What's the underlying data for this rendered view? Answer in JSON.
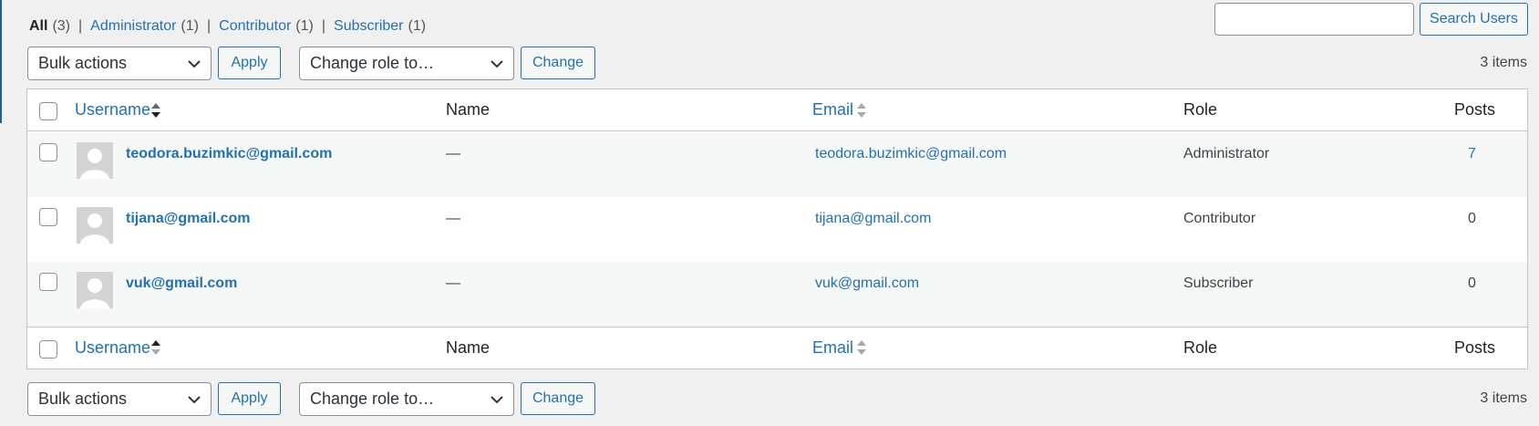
{
  "filters": [
    {
      "label": "All",
      "count": "(3)"
    },
    {
      "label": "Administrator",
      "count": "(1)"
    },
    {
      "label": "Contributor",
      "count": "(1)"
    },
    {
      "label": "Subscriber",
      "count": "(1)"
    }
  ],
  "separator": "|",
  "search": {
    "placeholder": "",
    "value": "",
    "button_label": "Search Users"
  },
  "top_nav": {
    "bulk_actions_selected": "Bulk actions",
    "apply_label": "Apply",
    "change_role_selected": "Change role to…",
    "change_label": "Change",
    "items_count": "3 items"
  },
  "bottom_nav": {
    "bulk_actions_selected": "Bulk actions",
    "apply_label": "Apply",
    "change_role_selected": "Change role to…",
    "change_label": "Change",
    "items_count": "3 items"
  },
  "columns": {
    "username": "Username",
    "name": "Name",
    "email": "Email",
    "role": "Role",
    "posts": "Posts"
  },
  "users": [
    {
      "username": "teodora.buzimkic@gmail.com",
      "name": "—",
      "email": "teodora.buzimkic@gmail.com",
      "role": "Administrator",
      "posts": "7"
    },
    {
      "username": "tijana@gmail.com",
      "name": "—",
      "email": "tijana@gmail.com",
      "role": "Contributor",
      "posts": "0"
    },
    {
      "username": "vuk@gmail.com",
      "name": "—",
      "email": "vuk@gmail.com",
      "role": "Subscriber",
      "posts": "0"
    }
  ],
  "colors": {
    "link": "#2271b1",
    "background": "#f0f0f1",
    "border": "#c3c4c7"
  },
  "icons": [
    "chevron-down-icon",
    "sort-desc-icon",
    "sort-icon",
    "sort-asc-icon",
    "avatar-placeholder-icon"
  ]
}
